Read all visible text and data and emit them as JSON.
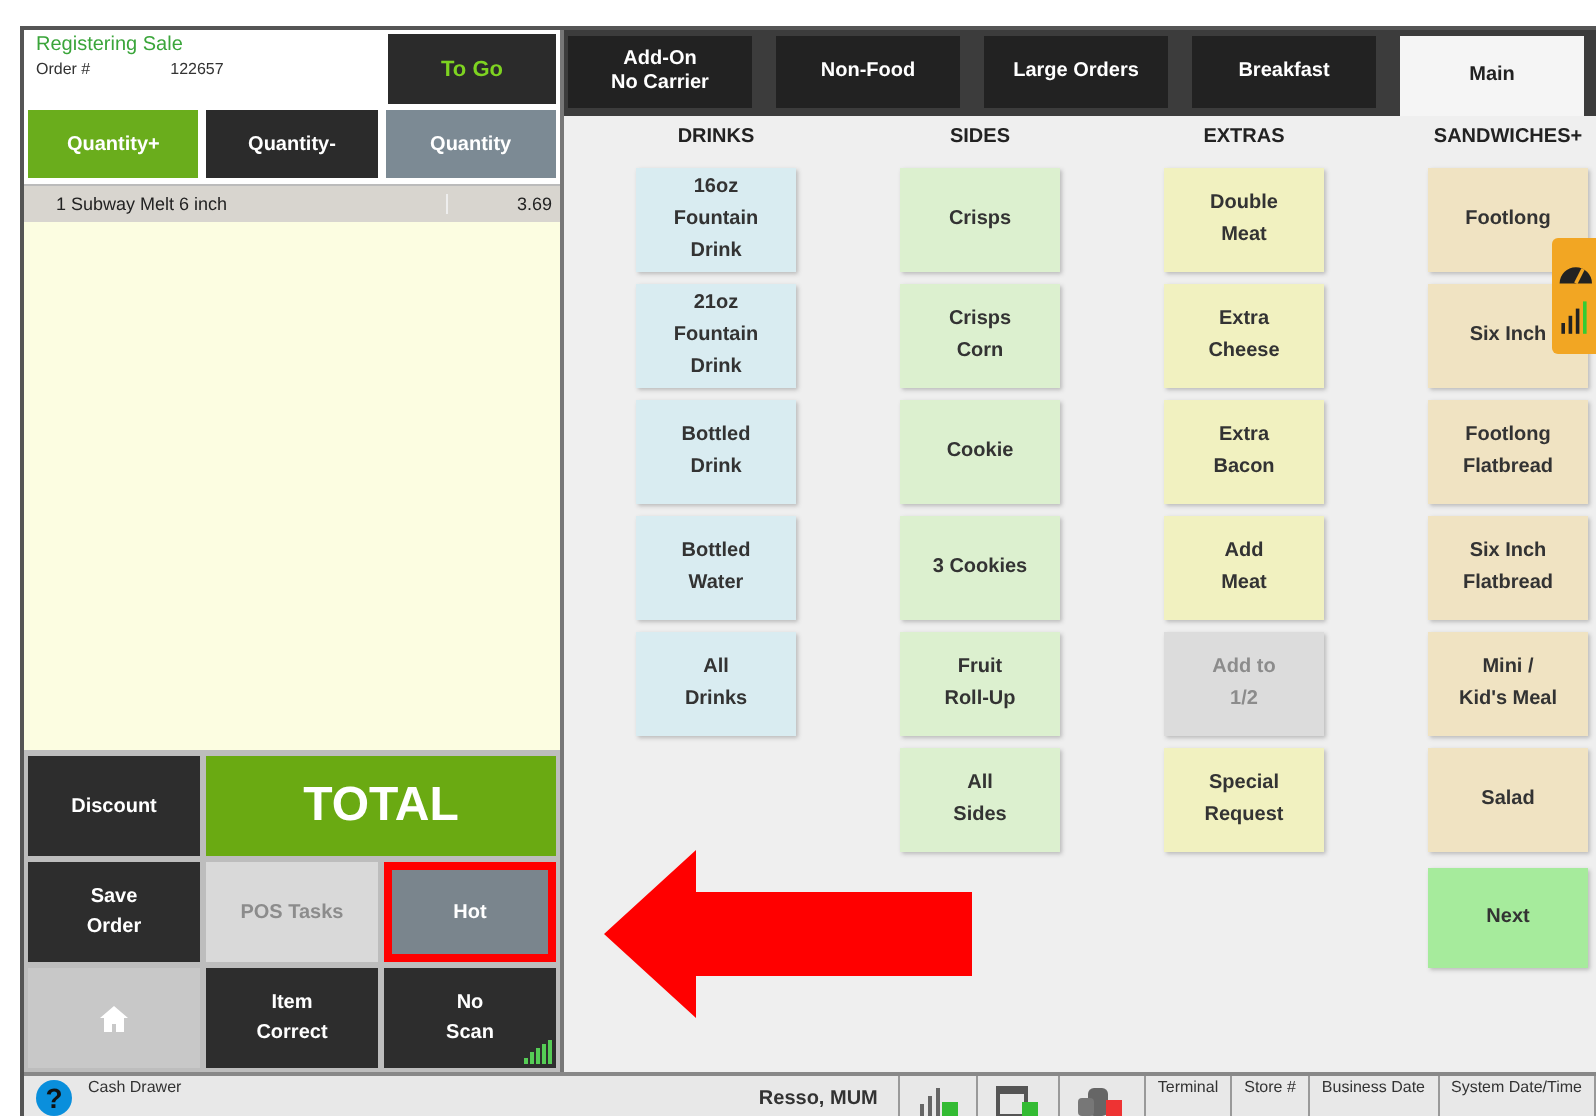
{
  "order_header": {
    "title": "Registering Sale",
    "order_label": "Order #",
    "order_number": "122657"
  },
  "to_go_button": "To Go",
  "quantity_buttons": [
    {
      "label": "Quantity+",
      "kind": "primary"
    },
    {
      "label": "Quantity-",
      "kind": "dark"
    },
    {
      "label": "Quantity",
      "kind": "muted"
    }
  ],
  "order_items": [
    {
      "qty": "1",
      "name": "Subway Melt 6 inch",
      "price": "3.69",
      "selected": true
    }
  ],
  "action_buttons": [
    {
      "label": "Discount",
      "kind": "dark",
      "highlighted": false
    },
    {
      "label": "TOTAL",
      "kind": "total",
      "highlighted": false
    },
    {
      "label": "Save\nOrder",
      "kind": "dark",
      "highlighted": false
    },
    {
      "label": "POS Tasks",
      "kind": "disabled",
      "highlighted": false
    },
    {
      "label": "Hot",
      "kind": "muted",
      "highlighted": true
    },
    {
      "kind": "home",
      "highlighted": false
    },
    {
      "label": "Item\nCorrect",
      "kind": "dark",
      "highlighted": false
    },
    {
      "label": "No\nScan",
      "kind": "scan",
      "highlighted": false
    }
  ],
  "tabs": [
    {
      "label": "Add-On\nNo Carrier",
      "selected": false
    },
    {
      "label": "Non-Food",
      "selected": false
    },
    {
      "label": "Large Orders",
      "selected": false
    },
    {
      "label": "Breakfast",
      "selected": false
    },
    {
      "label": "Main",
      "selected": true
    }
  ],
  "columns": [
    {
      "heading": "DRINKS",
      "color": "#d9ecf1",
      "buttons": [
        {
          "label": "16oz\nFountain\nDrink",
          "kind": "item",
          "disabled": false
        },
        {
          "label": "21oz\nFountain\nDrink",
          "kind": "item",
          "disabled": false
        },
        {
          "label": "Bottled\nDrink",
          "kind": "item",
          "disabled": false
        },
        {
          "label": "Bottled\nWater",
          "kind": "item",
          "disabled": false
        },
        {
          "label": "All\nDrinks",
          "kind": "item",
          "disabled": false
        }
      ]
    },
    {
      "heading": "SIDES",
      "color": "#dcf0cf",
      "buttons": [
        {
          "label": "Crisps",
          "kind": "item",
          "disabled": false
        },
        {
          "label": "Crisps\nCorn",
          "kind": "item",
          "disabled": false
        },
        {
          "label": "Cookie",
          "kind": "item",
          "disabled": false
        },
        {
          "label": "3 Cookies",
          "kind": "item",
          "disabled": false
        },
        {
          "label": "Fruit\nRoll-Up",
          "kind": "item",
          "disabled": false
        },
        {
          "label": "All\nSides",
          "kind": "item",
          "disabled": false
        }
      ]
    },
    {
      "heading": "EXTRAS",
      "color": "#f1f1c0",
      "buttons": [
        {
          "label": "Double\nMeat",
          "kind": "item",
          "disabled": false
        },
        {
          "label": "Extra\nCheese",
          "kind": "item",
          "disabled": false
        },
        {
          "label": "Extra\nBacon",
          "kind": "item",
          "disabled": false
        },
        {
          "label": "Add\nMeat",
          "kind": "item",
          "disabled": false
        },
        {
          "label": "Add to\n1/2",
          "kind": "item",
          "disabled": true
        },
        {
          "label": "Special\nRequest",
          "kind": "item",
          "disabled": false
        }
      ]
    },
    {
      "heading": "SANDWICHES+",
      "color": "#f0e3c2",
      "buttons": [
        {
          "label": "Footlong",
          "kind": "item",
          "disabled": false
        },
        {
          "label": "Six Inch",
          "kind": "item",
          "disabled": false
        },
        {
          "label": "Footlong\nFlatbread",
          "kind": "item",
          "disabled": false
        },
        {
          "label": "Six Inch\nFlatbread",
          "kind": "item",
          "disabled": false
        },
        {
          "label": "Mini /\nKid's Meal",
          "kind": "item",
          "disabled": false
        },
        {
          "label": "Salad",
          "kind": "item",
          "disabled": false
        },
        {
          "label": "Next",
          "kind": "nav",
          "disabled": false
        }
      ]
    }
  ],
  "status_bar": {
    "help": "?",
    "cash_drawer": "Cash Drawer",
    "user": "Resso, MUM",
    "fields": [
      "Terminal",
      "Store #",
      "Business Date",
      "System Date/Time"
    ]
  }
}
